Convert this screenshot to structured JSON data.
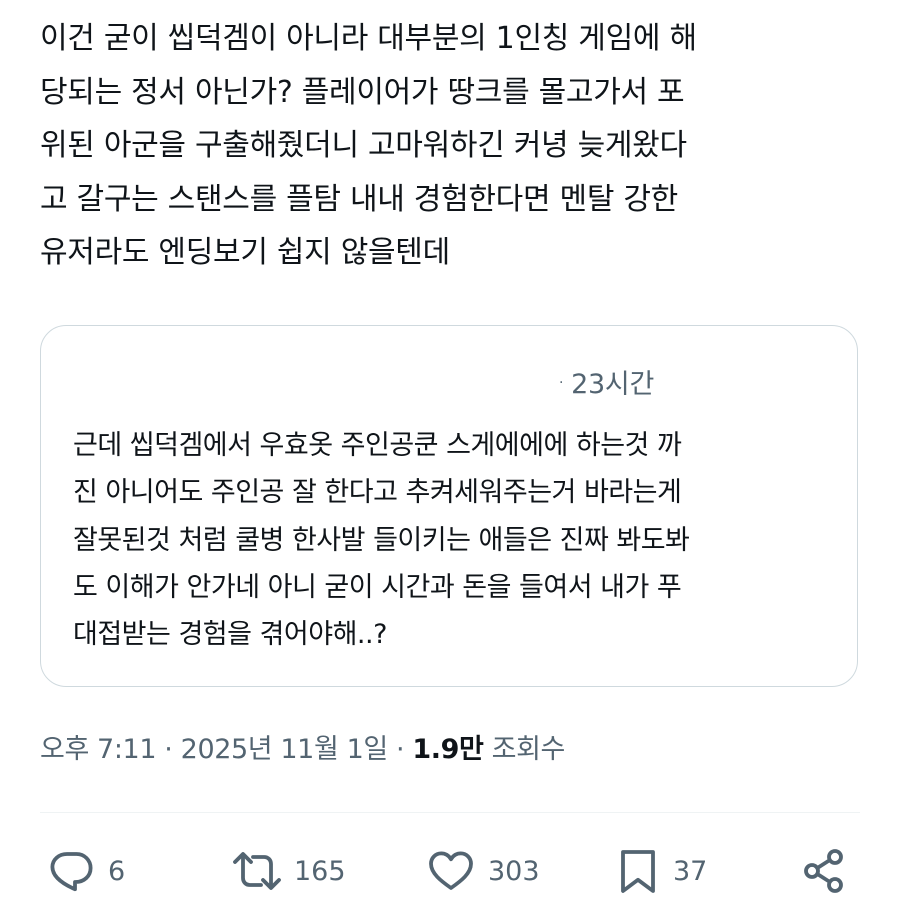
{
  "tweet": {
    "text": "이건 굳이 씹덕겜이 아니라 대부분의 1인칭 게임에 해\n당되는 정서 아닌가? 플레이어가 땅크를 몰고가서 포\n위된 아군을 구출해줬더니 고마워하긴 커녕 늦게왔다\n고 갈구는 스탠스를 플탐 내내 경험한다면 멘탈 강한\n유저라도 엔딩보기 쉽지 않을텐데"
  },
  "quote": {
    "separator": "·",
    "time": "23시간",
    "text": "근데 씹덕겜에서 우효옷 주인공쿤 스게에에에 하는것 까\n진 아니어도 주인공 잘 한다고 추켜세워주는거 바라는게\n잘못된것 처럼 쿨병 한사발 들이키는 애들은 진짜 봐도봐\n도 이해가 안가네 아니 굳이 시간과 돈을 들여서 내가 푸\n대접받는 경험을 겪어야해..?"
  },
  "meta": {
    "time": "오후 7:11",
    "sep1": " · ",
    "date": "2025년 11월 1일",
    "sep2": " · ",
    "views_count": "1.9만",
    "views_label": " 조회수"
  },
  "actions": {
    "reply_count": "6",
    "retweet_count": "165",
    "like_count": "303",
    "bookmark_count": "37"
  },
  "icons": {
    "reply": "reply-icon",
    "retweet": "retweet-icon",
    "like": "heart-icon",
    "bookmark": "bookmark-icon",
    "share": "share-icon"
  },
  "colors": {
    "text": "#0f1419",
    "secondary": "#536471",
    "border": "#cfd9de",
    "divider": "#eff3f4",
    "background": "#ffffff"
  }
}
